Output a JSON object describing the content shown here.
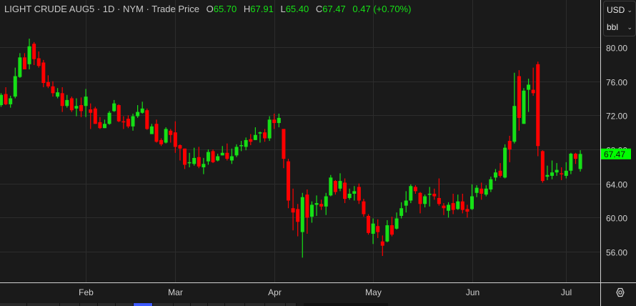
{
  "legend": {
    "symbol": "LIGHT CRUDE AUG5",
    "interval": "1D",
    "exchange": "NYM",
    "price_type": "Trade Price",
    "open_label": "O",
    "open": "65.70",
    "high_label": "H",
    "high": "67.91",
    "low_label": "L",
    "low": "65.40",
    "close_label": "C",
    "close": "67.47",
    "change": "0.47 (+0.70%)",
    "separator": "·"
  },
  "units": {
    "currency": "USD",
    "unit": "bbl"
  },
  "last_price_label": "67.47",
  "colors": {
    "up": "#16e016",
    "down": "#ff0000",
    "last_price_bg": "#00ff00",
    "background": "#1a1a1a",
    "grid": "#2c2c2c",
    "strip_active": "#3d5afe"
  },
  "settings_icon": "hexagon-settings-icon",
  "chart_data": {
    "type": "candlestick",
    "ylim": [
      52.5,
      83.5
    ],
    "yticks": [
      80,
      76,
      72,
      68,
      64,
      60,
      56
    ],
    "ytick_labels": [
      "80.00",
      "76.00",
      "72.00",
      "68.00",
      "64.00",
      "60.00",
      "56.00"
    ],
    "xtick_labels": [
      {
        "label": "Feb",
        "bar": 18
      },
      {
        "label": "Mar",
        "bar": 37
      },
      {
        "label": "Apr",
        "bar": 58
      },
      {
        "label": "May",
        "bar": 79
      },
      {
        "label": "Jun",
        "bar": 100
      },
      {
        "label": "Jul",
        "bar": 120
      }
    ],
    "ohlc": [
      [
        73.2,
        74.6,
        73.0,
        74.4
      ],
      [
        74.5,
        75.3,
        73.2,
        73.3
      ],
      [
        73.3,
        74.3,
        72.9,
        74.0
      ],
      [
        74.2,
        77.6,
        74.0,
        76.6
      ],
      [
        76.5,
        79.3,
        76.4,
        78.8
      ],
      [
        78.8,
        79.3,
        77.4,
        77.4
      ],
      [
        78.0,
        81.0,
        77.4,
        80.1
      ],
      [
        80.4,
        80.6,
        77.9,
        78.6
      ],
      [
        78.7,
        79.5,
        77.6,
        77.8
      ],
      [
        78.2,
        78.5,
        75.3,
        75.8
      ],
      [
        75.9,
        76.7,
        75.2,
        75.4
      ],
      [
        75.4,
        76.0,
        74.2,
        74.6
      ],
      [
        74.2,
        75.2,
        74.0,
        74.7
      ],
      [
        74.6,
        75.3,
        72.4,
        73.1
      ],
      [
        73.1,
        74.4,
        72.9,
        73.8
      ],
      [
        74.0,
        74.2,
        72.4,
        72.6
      ],
      [
        72.8,
        74.0,
        71.9,
        73.1
      ],
      [
        73.2,
        74.1,
        71.8,
        72.5
      ],
      [
        73.1,
        75.1,
        71.8,
        74.2
      ],
      [
        72.7,
        73.4,
        70.4,
        72.3
      ],
      [
        72.8,
        73.0,
        71.0,
        71.0
      ],
      [
        71.2,
        71.8,
        70.4,
        70.5
      ],
      [
        70.5,
        71.5,
        70.5,
        71.0
      ],
      [
        71.0,
        72.5,
        70.9,
        72.3
      ],
      [
        72.5,
        73.8,
        72.4,
        73.4
      ],
      [
        73.2,
        73.3,
        71.2,
        71.3
      ],
      [
        71.3,
        71.9,
        70.4,
        71.2
      ],
      [
        71.6,
        72.0,
        70.5,
        70.7
      ],
      [
        70.7,
        72.2,
        70.2,
        71.9
      ],
      [
        71.9,
        73.2,
        71.7,
        72.4
      ],
      [
        72.3,
        73.6,
        72.2,
        72.8
      ],
      [
        72.6,
        72.8,
        70.3,
        70.4
      ],
      [
        69.8,
        71.0,
        69.8,
        70.7
      ],
      [
        71.0,
        71.5,
        68.8,
        68.9
      ],
      [
        69.1,
        69.3,
        68.4,
        68.6
      ],
      [
        68.8,
        70.6,
        68.7,
        70.4
      ],
      [
        70.2,
        70.4,
        68.8,
        69.7
      ],
      [
        70.0,
        71.3,
        67.6,
        68.3
      ],
      [
        68.5,
        68.6,
        66.7,
        68.1
      ],
      [
        68.1,
        68.1,
        65.7,
        66.2
      ],
      [
        66.4,
        67.6,
        65.9,
        66.5
      ],
      [
        66.3,
        68.2,
        66.1,
        67.0
      ],
      [
        67.1,
        68.3,
        65.8,
        66.0
      ],
      [
        65.9,
        67.0,
        65.1,
        66.3
      ],
      [
        66.6,
        68.0,
        66.2,
        67.7
      ],
      [
        67.8,
        68.0,
        66.4,
        66.5
      ],
      [
        66.7,
        67.5,
        66.6,
        67.2
      ],
      [
        67.3,
        68.4,
        67.3,
        67.6
      ],
      [
        67.6,
        68.7,
        66.7,
        66.9
      ],
      [
        66.7,
        68.1,
        66.3,
        67.2
      ],
      [
        67.3,
        68.6,
        67.1,
        68.3
      ],
      [
        68.4,
        69.0,
        67.8,
        68.5
      ],
      [
        68.3,
        69.4,
        67.9,
        69.1
      ],
      [
        69.2,
        69.8,
        68.5,
        68.9
      ],
      [
        69.1,
        70.6,
        69.1,
        69.7
      ],
      [
        69.9,
        70.1,
        68.8,
        70.0
      ],
      [
        70.0,
        70.4,
        68.9,
        69.3
      ],
      [
        69.3,
        71.9,
        69.0,
        71.5
      ],
      [
        71.5,
        72.2,
        70.4,
        71.1
      ],
      [
        71.1,
        72.2,
        70.6,
        71.7
      ],
      [
        70.4,
        70.4,
        65.8,
        66.9
      ],
      [
        66.6,
        66.9,
        61.1,
        62.0
      ],
      [
        61.1,
        63.4,
        58.5,
        60.6
      ],
      [
        61.0,
        61.6,
        57.8,
        59.5
      ],
      [
        58.3,
        62.9,
        55.3,
        62.4
      ],
      [
        62.7,
        63.3,
        58.1,
        60.0
      ],
      [
        60.1,
        61.9,
        59.4,
        61.5
      ],
      [
        61.5,
        62.6,
        60.2,
        61.7
      ],
      [
        61.6,
        62.1,
        60.9,
        61.3
      ],
      [
        61.3,
        62.9,
        60.3,
        62.5
      ],
      [
        62.6,
        65.0,
        62.5,
        64.7
      ],
      [
        64.3,
        64.4,
        62.7,
        63.0
      ],
      [
        63.4,
        65.2,
        63.1,
        64.3
      ],
      [
        64.1,
        64.6,
        61.7,
        62.2
      ],
      [
        62.3,
        63.4,
        62.1,
        62.8
      ],
      [
        62.8,
        63.7,
        62.0,
        63.1
      ],
      [
        63.6,
        64.0,
        61.6,
        62.0
      ],
      [
        61.9,
        62.2,
        60.1,
        60.4
      ],
      [
        60.2,
        60.4,
        58.0,
        58.2
      ],
      [
        58.1,
        59.9,
        56.9,
        59.3
      ],
      [
        59.0,
        59.8,
        57.6,
        58.3
      ],
      [
        57.2,
        57.9,
        55.5,
        56.7
      ],
      [
        57.2,
        59.7,
        57.1,
        59.1
      ],
      [
        59.1,
        60.1,
        57.8,
        58.0
      ],
      [
        58.7,
        60.6,
        58.6,
        59.9
      ],
      [
        60.2,
        61.8,
        59.9,
        61.1
      ],
      [
        61.4,
        63.1,
        60.6,
        62.0
      ],
      [
        62.0,
        63.9,
        61.7,
        63.7
      ],
      [
        63.6,
        63.8,
        62.8,
        63.1
      ],
      [
        62.9,
        63.0,
        60.5,
        61.6
      ],
      [
        61.6,
        62.7,
        61.2,
        62.5
      ],
      [
        62.8,
        63.6,
        61.3,
        62.8
      ],
      [
        62.8,
        63.4,
        62.1,
        62.5
      ],
      [
        62.3,
        64.6,
        61.4,
        61.6
      ],
      [
        61.4,
        61.7,
        60.3,
        61.1
      ],
      [
        60.8,
        61.8,
        60.0,
        61.5
      ],
      [
        61.7,
        62.8,
        60.4,
        60.9
      ],
      [
        61.0,
        62.7,
        60.9,
        61.9
      ],
      [
        61.9,
        62.8,
        60.5,
        60.9
      ],
      [
        61.0,
        61.5,
        60.0,
        60.7
      ],
      [
        61.0,
        63.9,
        60.9,
        62.5
      ],
      [
        62.9,
        63.8,
        62.4,
        63.5
      ],
      [
        63.4,
        64.1,
        62.1,
        62.8
      ],
      [
        62.7,
        63.8,
        62.5,
        63.4
      ],
      [
        63.3,
        64.8,
        63.0,
        64.5
      ],
      [
        64.7,
        65.7,
        64.3,
        65.3
      ],
      [
        65.5,
        66.4,
        64.7,
        64.9
      ],
      [
        64.7,
        68.6,
        64.6,
        68.2
      ],
      [
        69.0,
        69.6,
        66.5,
        68.0
      ],
      [
        68.9,
        77.0,
        68.7,
        73.1
      ],
      [
        76.6,
        77.3,
        70.2,
        71.7
      ],
      [
        71.0,
        75.2,
        71.0,
        74.9
      ],
      [
        75.0,
        76.3,
        72.4,
        75.6
      ],
      [
        75.0,
        77.6,
        74.3,
        74.6
      ],
      [
        78.0,
        78.3,
        67.2,
        68.4
      ],
      [
        67.8,
        67.9,
        64.1,
        64.3
      ],
      [
        64.8,
        66.1,
        64.4,
        65.0
      ],
      [
        64.9,
        66.7,
        64.5,
        65.3
      ],
      [
        65.3,
        66.4,
        64.9,
        65.6
      ],
      [
        65.2,
        65.9,
        64.4,
        65.1
      ],
      [
        64.9,
        66.5,
        64.6,
        65.5
      ],
      [
        65.5,
        67.6,
        65.1,
        67.5
      ],
      [
        67.5,
        67.6,
        66.3,
        66.9
      ],
      [
        65.7,
        67.91,
        65.4,
        67.47
      ]
    ],
    "last_price": 67.47
  }
}
